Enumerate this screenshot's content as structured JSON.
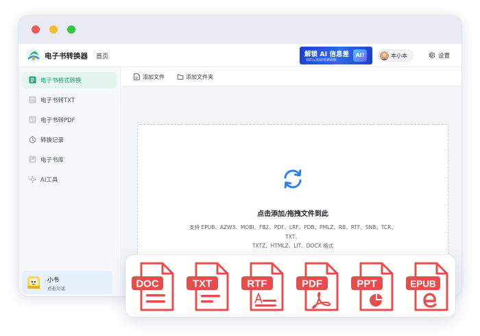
{
  "app": {
    "title": "电子书转换器",
    "nav_home": "首页",
    "brand_color": "#1aa179",
    "accent_blue": "#2f7ef0"
  },
  "promo": {
    "main": "解锁 AI 信息差",
    "sub": "你的认知即将被刷新",
    "badge": "AI!"
  },
  "user": {
    "name": "本小本",
    "avatar_icon": "user-avatar"
  },
  "header": {
    "settings_label": "设置",
    "settings_icon": "gear-icon"
  },
  "sidebar": {
    "items": [
      {
        "label": "电子书格式转换",
        "icon": "convert-icon",
        "active": true
      },
      {
        "label": "电子书转TXT",
        "icon": "txt-doc-icon",
        "active": false
      },
      {
        "label": "电子书转PDF",
        "icon": "pdf-doc-icon",
        "active": false
      },
      {
        "label": "转换记录",
        "icon": "clock-icon",
        "active": false
      },
      {
        "label": "电子书库",
        "icon": "library-icon",
        "active": false
      },
      {
        "label": "AI工具",
        "icon": "sparkle-icon",
        "active": false
      }
    ],
    "assistant": {
      "name": "小书",
      "sub": "点击对话"
    }
  },
  "toolbar": {
    "add_file": "添加文件",
    "add_folder": "添加文件夹"
  },
  "dropzone": {
    "title": "点击添加/拖拽文件到此",
    "formats_line1": "支持 EPUB、AZW3、MOBI、FB2、PDF、LRF、PDB、PMLZ、RB、RTF、SNB、TCR、TXT、",
    "formats_line2": "TXTZ、HTMLZ、LIT、DOCX 格式"
  },
  "format_cards": [
    {
      "label": "DOC",
      "glyph": "lines"
    },
    {
      "label": "TXT",
      "glyph": "lines"
    },
    {
      "label": "RTF",
      "glyph": "text-a"
    },
    {
      "label": "PDF",
      "glyph": "acrobat"
    },
    {
      "label": "PPT",
      "glyph": "pie"
    },
    {
      "label": "EPUB",
      "glyph": "e-mark"
    }
  ],
  "format_color": "#e84d4d"
}
